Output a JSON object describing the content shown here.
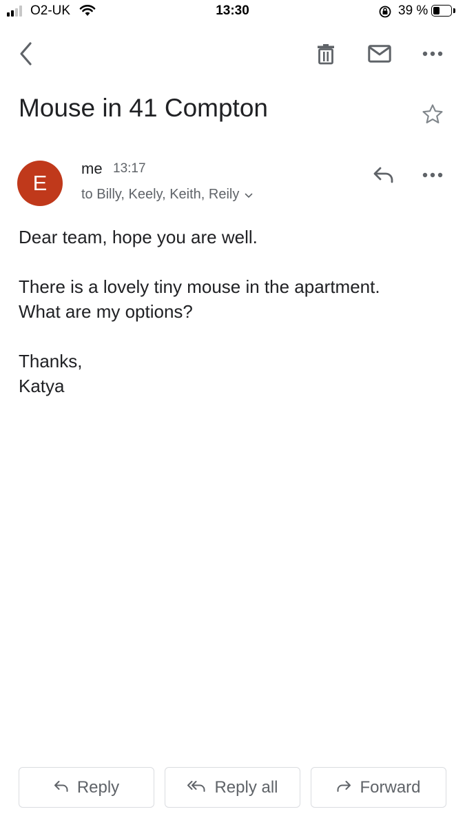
{
  "status_bar": {
    "carrier": "O2-UK",
    "time": "13:30",
    "battery_percent": "39 %",
    "battery_level": 0.39,
    "signal_bars": 2,
    "icons": [
      "signal-icon",
      "wifi-icon",
      "orientation-lock-icon",
      "battery-icon"
    ]
  },
  "toolbar": {
    "icons": [
      "back-chevron-icon",
      "trash-icon",
      "mail-icon",
      "more-vert-icon"
    ]
  },
  "email": {
    "subject": "Mouse in 41 Compton",
    "sender": "me",
    "time": "13:17",
    "avatar_letter": "E",
    "avatar_color": "#c0391b",
    "recipients": "to Billy, Keely, Keith, Reily",
    "body": {
      "line1": "Dear team, hope you are well.",
      "line2": "There is a lovely tiny mouse in the apartment.",
      "line3": "What are my options?",
      "line4": "Thanks,",
      "line5": "Katya"
    }
  },
  "actions": {
    "reply": "Reply",
    "reply_all": "Reply all",
    "forward": "Forward"
  }
}
